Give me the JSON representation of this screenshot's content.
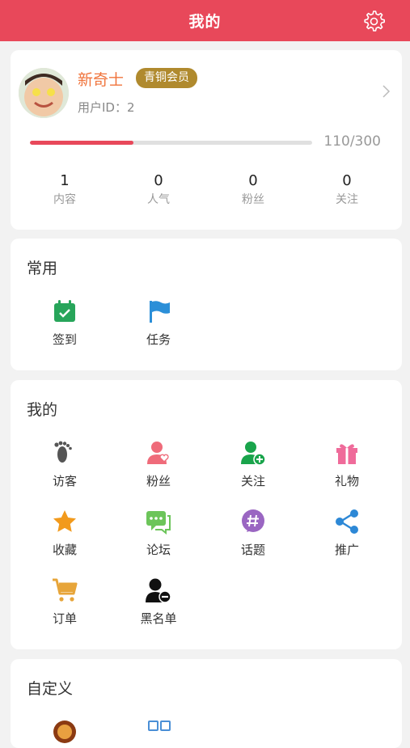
{
  "header": {
    "title": "我的"
  },
  "profile": {
    "name": "新奇士",
    "badge": "青铜会员",
    "user_id": "用户ID：2",
    "progress_text": "110/300",
    "progress_fraction": 0.367,
    "stats": [
      {
        "value": "1",
        "label": "内容"
      },
      {
        "value": "0",
        "label": "人气"
      },
      {
        "value": "0",
        "label": "粉丝"
      },
      {
        "value": "0",
        "label": "关注"
      }
    ]
  },
  "common": {
    "title": "常用",
    "items": [
      {
        "label": "签到",
        "icon": "calendar-check-icon",
        "color": "#27a55a"
      },
      {
        "label": "任务",
        "icon": "flag-icon",
        "color": "#2b8fd8"
      }
    ]
  },
  "mine": {
    "title": "我的",
    "items": [
      {
        "label": "访客",
        "icon": "footprints-icon",
        "color": "#555555"
      },
      {
        "label": "粉丝",
        "icon": "user-heart-icon",
        "color": "#ef6b7a"
      },
      {
        "label": "关注",
        "icon": "user-add-icon",
        "color": "#19a44b"
      },
      {
        "label": "礼物",
        "icon": "gift-icon",
        "color": "#ef6b9a"
      },
      {
        "label": "收藏",
        "icon": "star-icon",
        "color": "#f29a1c"
      },
      {
        "label": "论坛",
        "icon": "chat-icon",
        "color": "#6cc55a"
      },
      {
        "label": "话题",
        "icon": "hashtag-icon",
        "color": "#9a66c2"
      },
      {
        "label": "推广",
        "icon": "share-icon",
        "color": "#2d88d6"
      },
      {
        "label": "订单",
        "icon": "cart-icon",
        "color": "#e7a53a"
      },
      {
        "label": "黑名单",
        "icon": "user-block-icon",
        "color": "#111111"
      }
    ]
  },
  "custom": {
    "title": "自定义"
  }
}
